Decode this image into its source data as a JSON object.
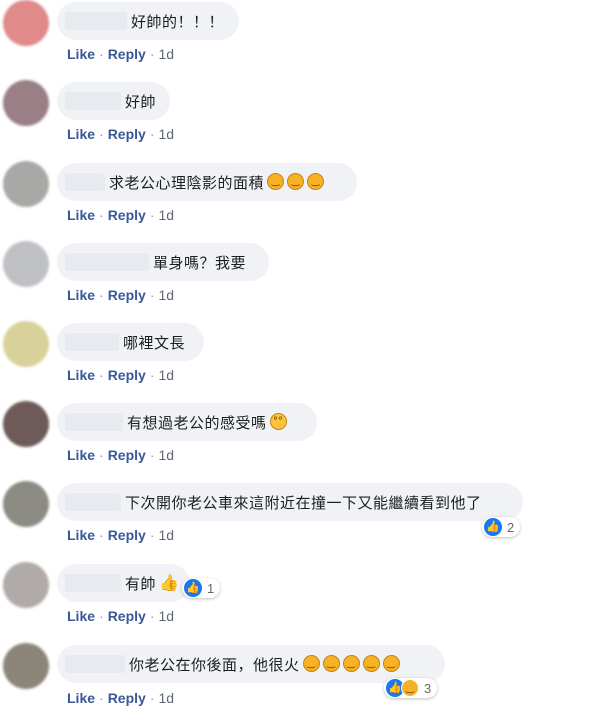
{
  "actions": {
    "like": "Like",
    "reply": "Reply",
    "sep": "·",
    "time": "1d"
  },
  "colors": {
    "link": "#385898",
    "bubble": "#f0f2f5",
    "like_blue": "#1877f2"
  },
  "comments": [
    {
      "text": "好帥的！！！",
      "emojis": [],
      "avatar_color": "#e08a8a"
    },
    {
      "text": "好帥",
      "emojis": [],
      "avatar_color": "#9b7f86"
    },
    {
      "text": "求老公心理陰影的面積",
      "emojis": [
        "laughing-crying-emoji",
        "laughing-crying-emoji",
        "laughing-crying-emoji"
      ],
      "avatar_color": "#a8a8a6"
    },
    {
      "text": "單身嗎？我要",
      "emojis": [],
      "avatar_color": "#bfc0c4"
    },
    {
      "text": "哪裡文長",
      "emojis": [],
      "avatar_color": "#d8d29a"
    },
    {
      "text": "有想過老公的感受嗎",
      "emojis": [
        "flushed-emoji"
      ],
      "avatar_color": "#6e5a58"
    },
    {
      "text": "下次開你老公車來這附近在撞一下又能繼續看到他了",
      "emojis": [],
      "avatar_color": "#8b8b84",
      "reactions": {
        "types": [
          "like"
        ],
        "count": "2"
      }
    },
    {
      "text": "有帥",
      "emojis": [
        "thumbs-up-emoji"
      ],
      "avatar_color": "#b0aaa8",
      "reactions": {
        "types": [
          "like"
        ],
        "count": "1"
      }
    },
    {
      "text": "你老公在你後面，他很火",
      "emojis": [
        "laughing-crying-emoji",
        "laughing-crying-emoji",
        "laughing-crying-emoji",
        "laughing-crying-emoji",
        "laughing-crying-emoji"
      ],
      "avatar_color": "#8c8579",
      "reactions": {
        "types": [
          "like",
          "haha"
        ],
        "count": "3"
      }
    }
  ]
}
